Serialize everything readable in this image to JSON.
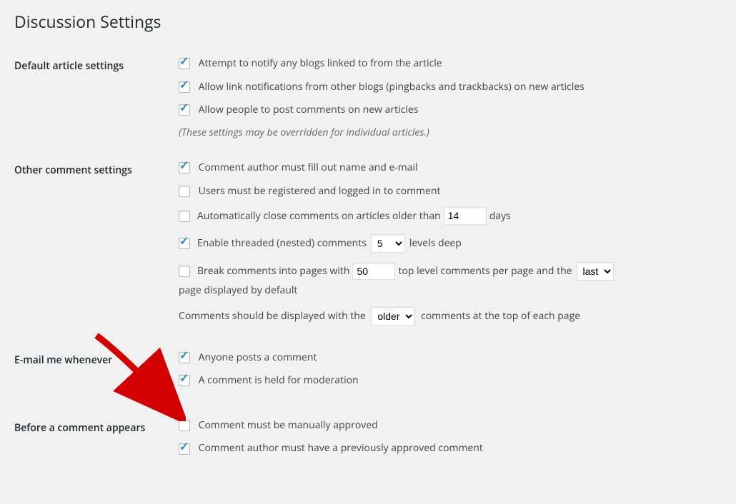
{
  "page_title": "Discussion Settings",
  "sections": {
    "default_article": {
      "heading": "Default article settings",
      "pingback": "Attempt to notify any blogs linked to from the article",
      "allow_pings": "Allow link notifications from other blogs (pingbacks and trackbacks) on new articles",
      "allow_comments": "Allow people to post comments on new articles",
      "note": "(These settings may be overridden for individual articles.)"
    },
    "other_comment": {
      "heading": "Other comment settings",
      "require_name_email": "Comment author must fill out name and e-mail",
      "require_registration": "Users must be registered and logged in to comment",
      "close_comments_prefix": "Automatically close comments on articles older than",
      "close_comments_days_value": "14",
      "close_comments_suffix": "days",
      "threaded_prefix": "Enable threaded (nested) comments",
      "threaded_levels_value": "5",
      "threaded_suffix": "levels deep",
      "paginate_prefix": "Break comments into pages with",
      "paginate_per_page_value": "50",
      "paginate_mid": "top level comments per page and the",
      "paginate_default_value": "last",
      "paginate_suffix": "page displayed by default",
      "order_prefix": "Comments should be displayed with the",
      "order_value": "older",
      "order_suffix": "comments at the top of each page"
    },
    "email_me": {
      "heading": "E-mail me whenever",
      "anyone_posts": "Anyone posts a comment",
      "held_moderation": "A comment is held for moderation"
    },
    "before_appears": {
      "heading": "Before a comment appears",
      "manual_approve": "Comment must be manually approved",
      "previously_approved": "Comment author must have a previously approved comment"
    }
  }
}
